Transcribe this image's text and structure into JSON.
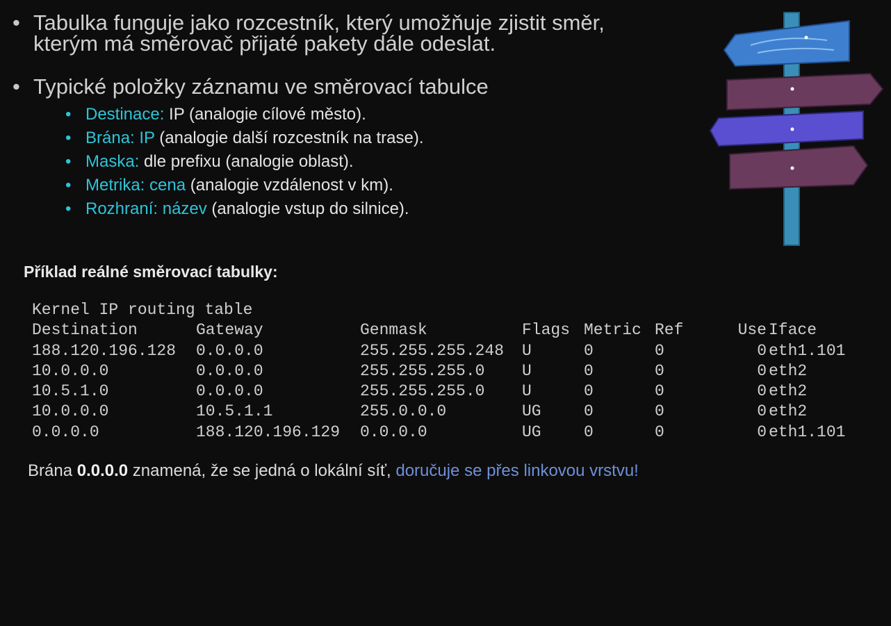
{
  "bullets": [
    {
      "lines": [
        "Tabulka funguje jako rozcestník, který umožňuje zjistit směr,",
        "kterým má směrovač přijaté pakety dále odeslat."
      ]
    },
    {
      "text": "Typické položky záznamu ve směrovací tabulce",
      "subitems": [
        {
          "key": "Destinace:",
          "rest": " IP (analogie cílové město)."
        },
        {
          "key": "Brána: IP",
          "rest": " (analogie další rozcestník na trase)."
        },
        {
          "key": "Maska:",
          "rest": " dle prefixu (analogie oblast)."
        },
        {
          "key": "Metrika: cena",
          "rest": " (analogie vzdálenost v km)."
        },
        {
          "key": "Rozhraní: název",
          "rest": " (analogie vstup do silnice)."
        }
      ]
    }
  ],
  "example_title": "Příklad reálné směrovací tabulky:",
  "terminal": {
    "title": "Kernel IP routing table",
    "headers": [
      "Destination",
      "Gateway",
      "Genmask",
      "Flags",
      "Metric",
      "Ref",
      "Use",
      "Iface"
    ],
    "rows": [
      [
        "188.120.196.128",
        "0.0.0.0",
        "255.255.255.248",
        "U",
        "0",
        "0",
        "0",
        "eth1.101"
      ],
      [
        "10.0.0.0",
        "0.0.0.0",
        "255.255.255.0",
        "U",
        "0",
        "0",
        "0",
        "eth2"
      ],
      [
        "10.5.1.0",
        "0.0.0.0",
        "255.255.255.0",
        "U",
        "0",
        "0",
        "0",
        "eth2"
      ],
      [
        "10.0.0.0",
        "10.5.1.1",
        "255.0.0.0",
        "UG",
        "0",
        "0",
        "0",
        "eth2"
      ],
      [
        "0.0.0.0",
        "188.120.196.129",
        "0.0.0.0",
        "UG",
        "0",
        "0",
        "0",
        "eth1.101"
      ]
    ]
  },
  "footer": {
    "prefix": "Brána ",
    "bold": "0.0.0.0",
    "middle": " znamená, že se jedná o lokální síť, ",
    "highlight": "doručuje se přes linkovou vrstvu!"
  },
  "colors": {
    "background": "#0d0d0d",
    "accent_cyan": "#2ec4d8",
    "footer_blue": "#6f8fd8",
    "sign_post": "#3a8fb8",
    "sign_blue": "#3f7fd0",
    "sign_purple": "#6b3b5e",
    "sign_violet": "#5a4fd0"
  },
  "icons": {
    "signpost": "signpost-illustration"
  }
}
